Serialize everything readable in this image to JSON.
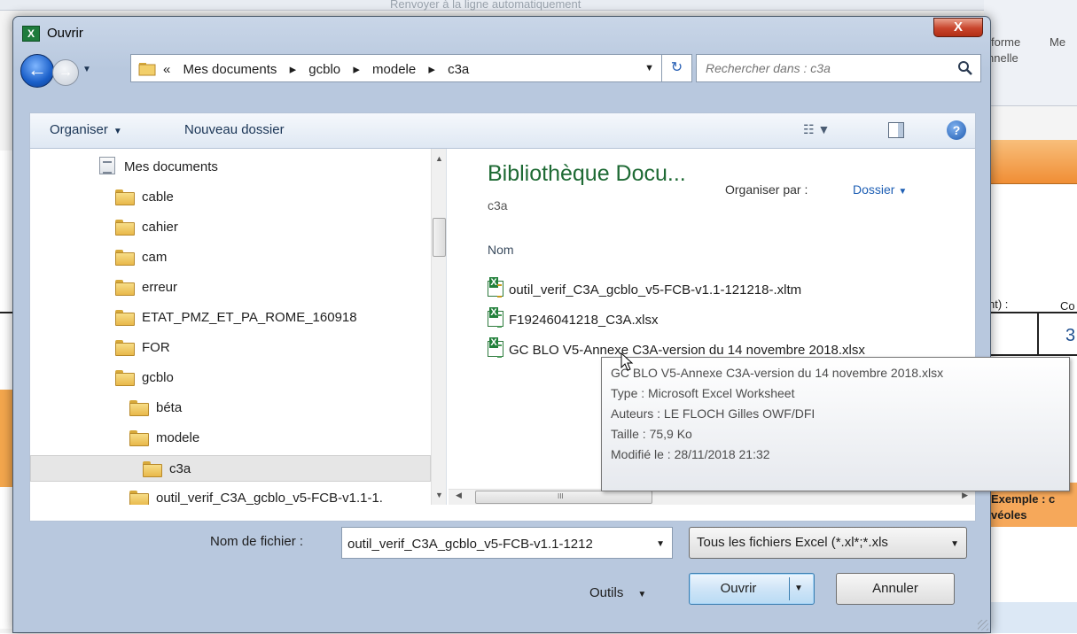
{
  "background": {
    "ribbon_wrap_text": "Renvoyer à la ligne automatiquement",
    "ribbon_right_1": "forme",
    "ribbon_right_2": "Me",
    "ribbon_right_3": "nnelle",
    "sheet_label_1": "nt) :",
    "sheet_label_2": "Co",
    "sheet_digit": "3",
    "sheet_example": "Exemple : c",
    "sheet_alveoles": "véoles"
  },
  "dialog": {
    "title": "Ouvrir",
    "close_symbol": "X"
  },
  "address": {
    "crumbs": [
      "«",
      "Mes documents",
      "▸",
      "gcblo",
      "▸",
      "modele",
      "▸",
      "c3a"
    ],
    "search_placeholder": "Rechercher dans : c3a"
  },
  "toolbar": {
    "organize": "Organiser",
    "new_folder": "Nouveau dossier"
  },
  "nav_tree": [
    {
      "label": "Mes documents",
      "type": "doc",
      "indent": 0
    },
    {
      "label": "cable",
      "type": "folder",
      "indent": 1
    },
    {
      "label": "cahier",
      "type": "folder",
      "indent": 1
    },
    {
      "label": "cam",
      "type": "folder",
      "indent": 1
    },
    {
      "label": "erreur",
      "type": "folder",
      "indent": 1
    },
    {
      "label": "ETAT_PMZ_ET_PA_ROME_160918",
      "type": "folder",
      "indent": 1
    },
    {
      "label": "FOR",
      "type": "folder",
      "indent": 1
    },
    {
      "label": "gcblo",
      "type": "folder",
      "indent": 1
    },
    {
      "label": "béta",
      "type": "folder",
      "indent": 2
    },
    {
      "label": "modele",
      "type": "folder",
      "indent": 2
    },
    {
      "label": "c3a",
      "type": "folder",
      "indent": 3,
      "selected": true
    },
    {
      "label": "outil_verif_C3A_gcblo_v5-FCB-v1.1-1.",
      "type": "folder",
      "indent": 2
    }
  ],
  "content": {
    "library_title": "Bibliothèque Docu...",
    "library_subtitle": "c3a",
    "arrange_label": "Organiser par :",
    "arrange_value": "Dossier",
    "column_name": "Nom",
    "files": [
      {
        "name": "outil_verif_C3A_gcblo_v5-FCB-v1.1-121218-.xltm",
        "icon": "excel-macro-icon"
      },
      {
        "name": "F19246041218_C3A.xlsx",
        "icon": "excel-file-icon"
      },
      {
        "name": "GC BLO V5-Annexe C3A-version du 14 novembre 2018.xlsx",
        "icon": "excel-file-icon"
      }
    ]
  },
  "tooltip": {
    "name": "GC BLO V5-Annexe C3A-version du 14 novembre 2018.xlsx",
    "type": "Type : Microsoft Excel Worksheet",
    "authors": "Auteurs : LE FLOCH Gilles OWF/DFI",
    "size": "Taille : 75,9 Ko",
    "modified": "Modifié le : 28/11/2018 21:32"
  },
  "footer": {
    "filename_label": "Nom de fichier :",
    "filename_value": "outil_verif_C3A_gcblo_v5-FCB-v1.1-1212",
    "filetype_value": "Tous les fichiers Excel (*.xl*;*.xls",
    "tools_label": "Outils",
    "open_label": "Ouvrir",
    "cancel_label": "Annuler"
  }
}
